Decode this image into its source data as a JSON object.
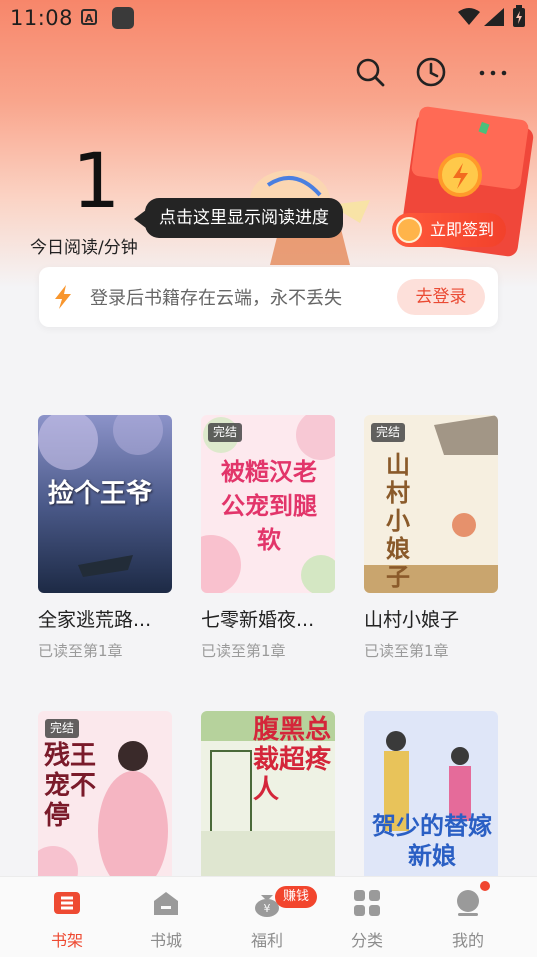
{
  "status_bar": {
    "time": "11:08",
    "a_glyph": "A"
  },
  "toolbar": {
    "icons": [
      "search-icon",
      "history-clock-icon",
      "more-icon"
    ]
  },
  "reading": {
    "minutes": "1",
    "label": "今日阅读/分钟",
    "tooltip": "点击这里显示阅读进度"
  },
  "signin": {
    "label": "立即签到"
  },
  "login_banner": {
    "text": "登录后书籍存在云端，永不丢失",
    "button": "去登录"
  },
  "books": [
    {
      "title": "全家逃荒路...",
      "progress": "已读至第1章",
      "badge": "",
      "cover_text": "捡个王爷"
    },
    {
      "title": "七零新婚夜...",
      "progress": "已读至第1章",
      "badge": "完结",
      "cover_text": "被糙汉老公宠到腿软"
    },
    {
      "title": "山村小娘子",
      "progress": "已读至第1章",
      "badge": "完结",
      "cover_text": "山村小娘子"
    },
    {
      "title": "",
      "progress": "",
      "badge": "完结",
      "cover_text": "残王宠不停"
    },
    {
      "title": "",
      "progress": "",
      "badge": "",
      "cover_text": "腹黑总裁超疼人"
    },
    {
      "title": "",
      "progress": "",
      "badge": "",
      "cover_text": "贺少的替嫁新娘"
    }
  ],
  "nav": {
    "items": [
      {
        "label": "书架",
        "icon": "bookshelf-icon",
        "active": true
      },
      {
        "label": "书城",
        "icon": "bookstore-icon",
        "active": false
      },
      {
        "label": "福利",
        "icon": "welfare-bag-icon",
        "active": false
      },
      {
        "label": "分类",
        "icon": "category-grid-icon",
        "active": false
      },
      {
        "label": "我的",
        "icon": "profile-icon",
        "active": false
      }
    ],
    "earn_badge": "赚钱"
  },
  "colors": {
    "accent": "#ee4a32",
    "hero_top": "#f7866a",
    "nav_inactive": "#8c8c8c"
  }
}
